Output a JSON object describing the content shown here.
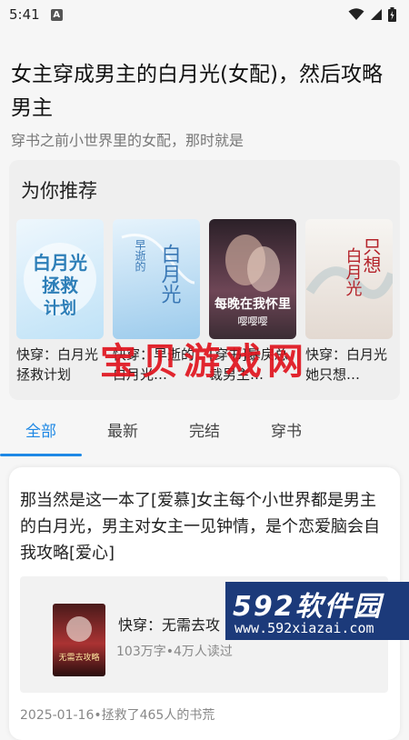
{
  "status_bar": {
    "time": "5:41",
    "notification_icon": "A"
  },
  "post": {
    "title": "女主穿成男主的白月光(女配)，然后攻略男主",
    "subtitle": "穿书之前小世界里的女配，那时就是"
  },
  "recommend": {
    "title": "为你推荐",
    "books": [
      {
        "name": "快穿：白月光拯救计划",
        "cover_text": "白月光拯救计划",
        "cover_colors": [
          "#dff0fb",
          "#bfe2f7"
        ]
      },
      {
        "name": "快穿：早逝的白月光…",
        "cover_text": "白月光",
        "cover_colors": [
          "#d8ecfa",
          "#a9d2f0"
        ]
      },
      {
        "name": "[穿书]暴戾总裁男主…",
        "cover_text": "每晚在我怀里",
        "cover_colors": [
          "#3a2a35",
          "#8a5a6a"
        ]
      },
      {
        "name": "快穿：白月光她只想…",
        "cover_text": "只想白月光活着",
        "cover_colors": [
          "#f4f2ef",
          "#e6dcd4"
        ]
      }
    ]
  },
  "watermark": "宝贝游戏网",
  "tabs": [
    {
      "label": "全部",
      "active": true
    },
    {
      "label": "最新",
      "active": false
    },
    {
      "label": "完结",
      "active": false
    },
    {
      "label": "穿书",
      "active": false
    }
  ],
  "comment": {
    "text": "那当然是这一本了[爱慕]女主每个小世界都是男主的白月光，男主对女主一见钟情，是个恋爱脑会自我攻略[爱心]",
    "book": {
      "name": "快穿：无需去攻",
      "meta": "103万字•4万人读过",
      "cover_text": "无需去攻略"
    },
    "footer": "2025-01-16•拯救了465人的书荒"
  },
  "site_logo": {
    "big": "592软件园",
    "url": "www.592xiazai.com"
  },
  "colors": {
    "accent": "#1e88e5",
    "watermark": "#e0141e",
    "logo_bg": "#1c3a7a"
  }
}
